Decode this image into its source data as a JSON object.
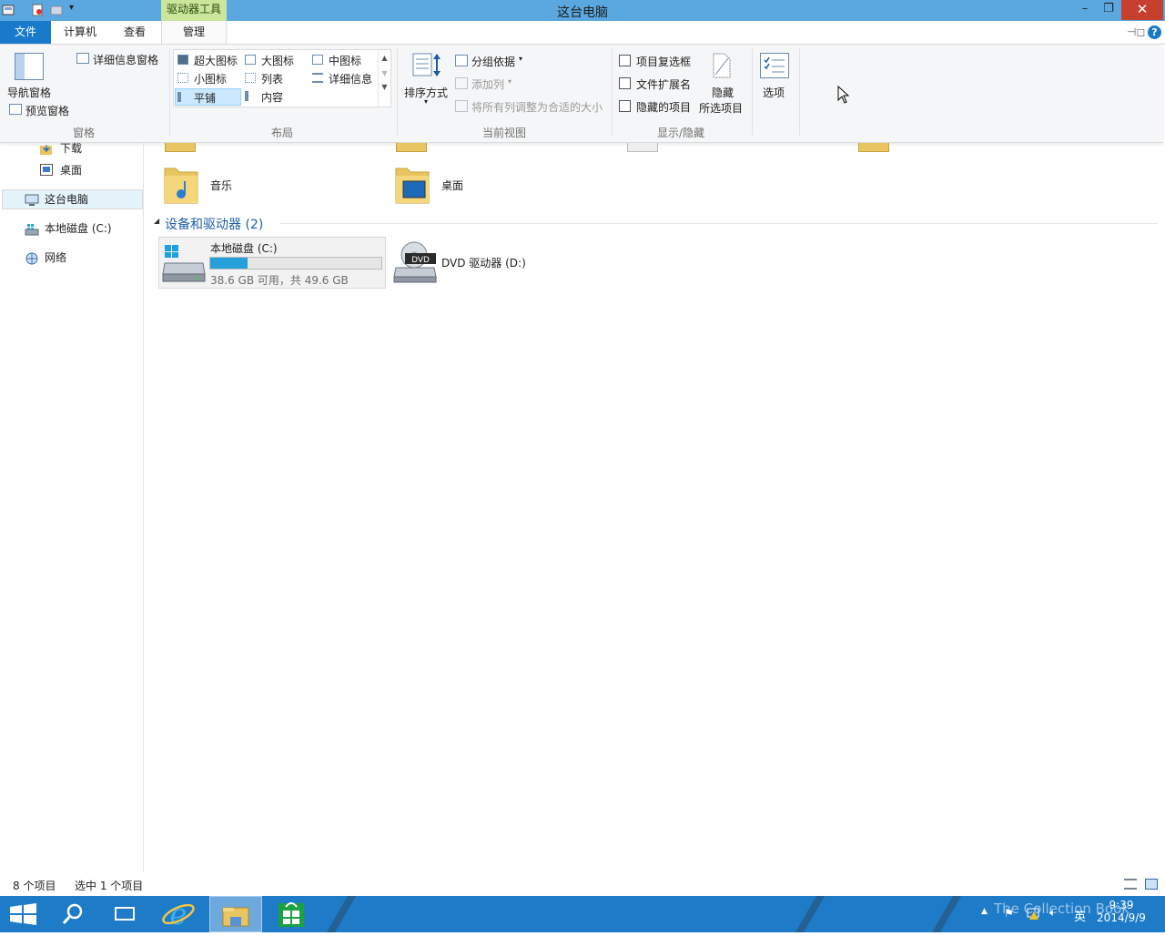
{
  "window": {
    "title": "这台电脑",
    "context_tab": "驱动器工具"
  },
  "tabs": {
    "file": "文件",
    "computer": "计算机",
    "view": "查看",
    "manage": "管理"
  },
  "ribbon": {
    "pane": {
      "nav_pane": "导航窗格",
      "preview_pane": "预览窗格",
      "details_pane": "详细信息窗格",
      "group": "窗格"
    },
    "layout": {
      "xl_icons": "超大图标",
      "l_icons": "大图标",
      "m_icons": "中图标",
      "s_icons": "小图标",
      "list": "列表",
      "details": "详细信息",
      "tiles": "平铺",
      "content": "内容",
      "group": "布局"
    },
    "current_view": {
      "sort_by": "排序方式",
      "group_by": "分组依据",
      "add_column": "添加列",
      "size_all": "将所有列调整为合适的大小",
      "group": "当前视图"
    },
    "show_hide": {
      "item_checkboxes": "项目复选框",
      "file_ext": "文件扩展名",
      "hidden_items": "隐藏的项目",
      "hide_selected_1": "隐藏",
      "hide_selected_2": "所选项目",
      "group": "显示/隐藏"
    },
    "options": "选项"
  },
  "sidebar": {
    "downloads": "下载",
    "desktop": "桌面",
    "this_pc": "这台电脑",
    "local_disk": "本地磁盘 (C:)",
    "network": "网络"
  },
  "content": {
    "folders": [
      {
        "name": "音乐"
      },
      {
        "name": "桌面"
      }
    ],
    "section_title": "设备和驱动器 (2)",
    "drive_c": {
      "name": "本地磁盘 (C:)",
      "free": "38.6 GB 可用，共 49.6 GB",
      "used_fraction": 0.22
    },
    "drive_d": {
      "name": "DVD 驱动器 (D:)",
      "badge": "DVD"
    }
  },
  "status": {
    "count": "8 个项目",
    "selected": "选中 1 个项目"
  },
  "taskbar": {
    "lang": "英",
    "time": "9:39",
    "date": "2014/9/9",
    "watermark": "The Collection Book"
  },
  "colors": {
    "titlebar": "#5ba8e0",
    "file_tab": "#1979ca",
    "taskbar": "#1d7bc8",
    "close": "#c7402e",
    "accent_text": "#1e5fa4",
    "progress": "#26a0da"
  }
}
